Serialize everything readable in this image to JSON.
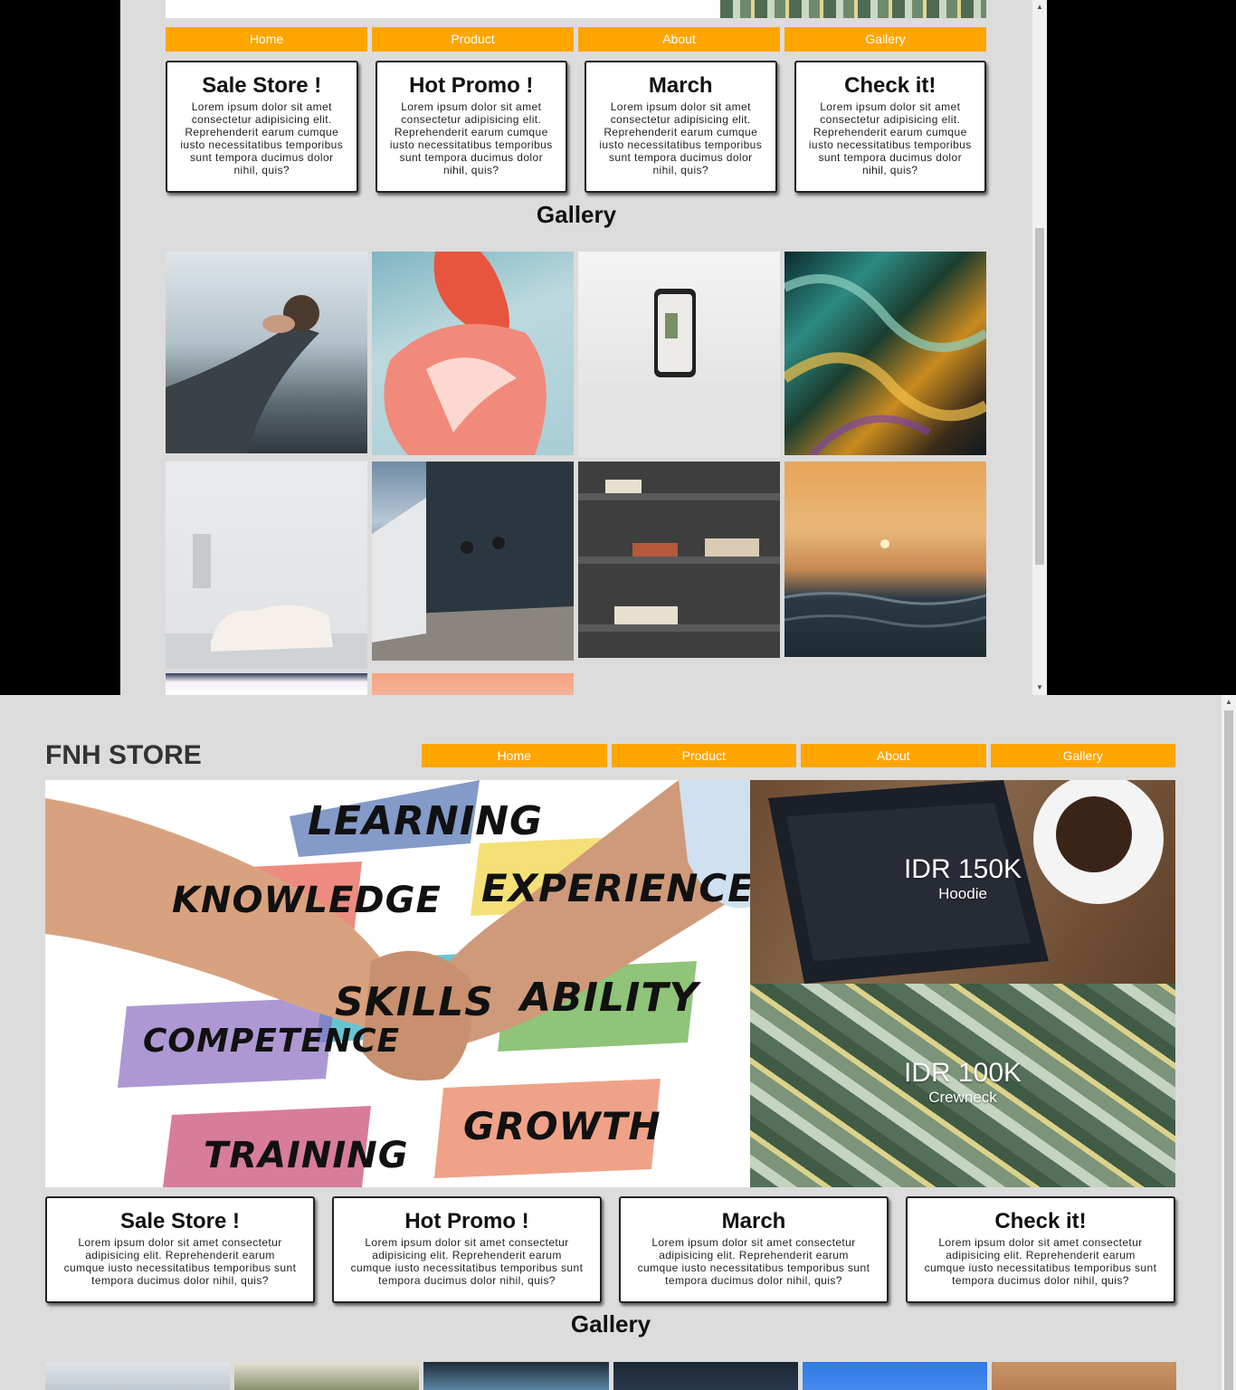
{
  "store_name": "FNH STORE",
  "nav": [
    "Home",
    "Product",
    "About",
    "Gallery"
  ],
  "cards": [
    {
      "title": "Sale Store !",
      "text": "Lorem ipsum dolor sit amet consectetur adipisicing elit. Reprehenderit earum cumque iusto necessitatibus temporibus sunt tempora ducimus dolor nihil, quis?"
    },
    {
      "title": "Hot Promo !",
      "text": "Lorem ipsum dolor sit amet consectetur adipisicing elit. Reprehenderit earum cumque iusto necessitatibus temporibus sunt tempora ducimus dolor nihil, quis?"
    },
    {
      "title": "March",
      "text": "Lorem ipsum dolor sit amet consectetur adipisicing elit. Reprehenderit earum cumque iusto necessitatibus temporibus sunt tempora ducimus dolor nihil, quis?"
    },
    {
      "title": "Check it!",
      "text": "Lorem ipsum dolor sit amet consectetur adipisicing elit. Reprehenderit earum cumque iusto necessitatibus temporibus sunt tempora ducimus dolor nihil, quis?"
    }
  ],
  "gallery_title": "Gallery",
  "hero_words": [
    "LEARNING",
    "KNOWLEDGE",
    "EXPERIENCE",
    "SKILLS",
    "ABILITY",
    "COMPETENCE",
    "TRAINING",
    "GROWTH"
  ],
  "promos": [
    {
      "price": "IDR 150K",
      "name": "Hoodie"
    },
    {
      "price": "IDR 100K",
      "name": "Crewneck"
    }
  ],
  "colors": {
    "accent": "#ffa500",
    "page_bg": "#dcdcdc"
  }
}
